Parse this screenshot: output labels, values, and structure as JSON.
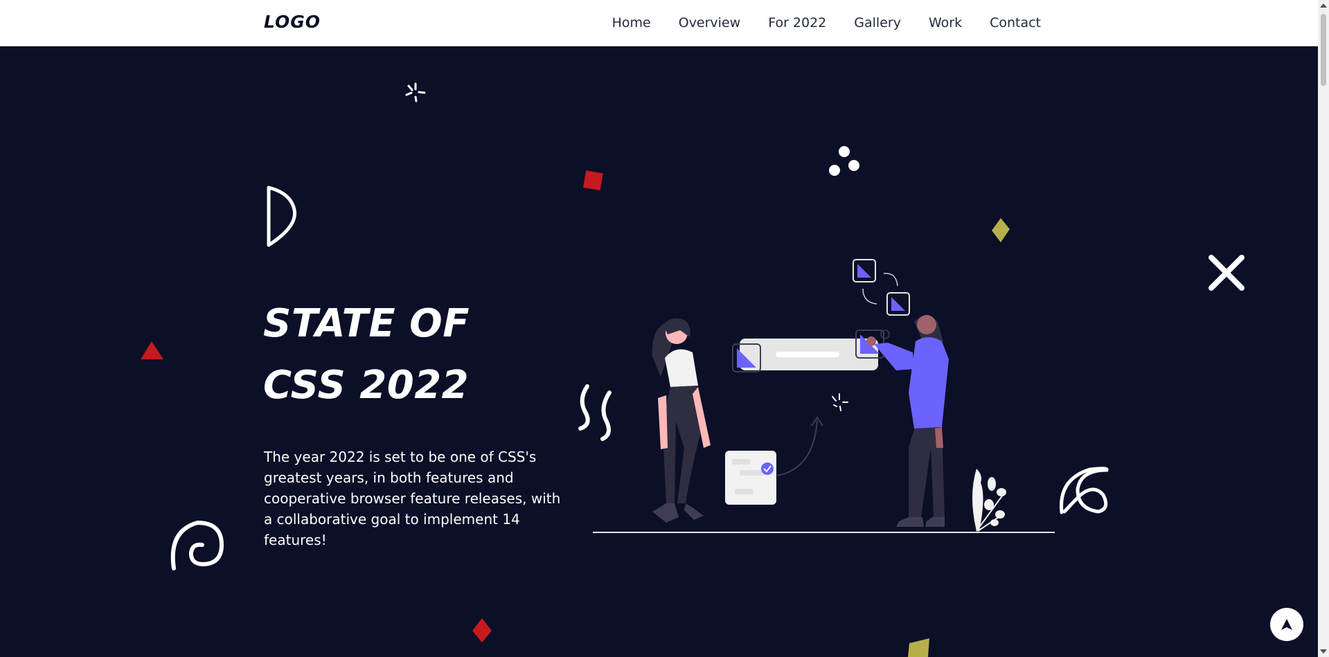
{
  "nav": {
    "logo": "LOGO",
    "links": [
      "Home",
      "Overview",
      "For 2022",
      "Gallery",
      "Work",
      "Contact"
    ]
  },
  "hero": {
    "title_line1": "STATE OF",
    "title_line2": "CSS 2022",
    "description": "The year 2022 is set to be one of CSS's greatest years, in both features and cooperative browser feature releases, with a collaborative goal to implement 14 features!"
  },
  "colors": {
    "background": "#0b0f27",
    "accent_purple": "#6c63ff",
    "shape_red": "#c61a1f",
    "shape_olive": "#b5b04a"
  },
  "icons": [
    "arrow-up-icon",
    "close-x-icon"
  ]
}
